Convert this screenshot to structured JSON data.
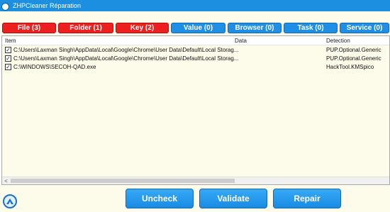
{
  "window": {
    "title": "ZHPCleaner Réparation",
    "app_icon": "zhpcleaner-logo-icon"
  },
  "tabs": [
    {
      "label": "File  (3)",
      "color": "#ee1f1f"
    },
    {
      "label": "Folder  (1)",
      "color": "#ee1f1f"
    },
    {
      "label": "Key  (2)",
      "color": "#ee1f1f"
    },
    {
      "label": "Value  (0)",
      "color": "#1f8fe6"
    },
    {
      "label": "Browser  (0)",
      "color": "#1f8fe6"
    },
    {
      "label": "Task  (0)",
      "color": "#1f8fe6"
    },
    {
      "label": "Service  (0)",
      "color": "#1f8fe6"
    }
  ],
  "list": {
    "columns": {
      "item": "Item",
      "data": "Data",
      "detection": "Detection"
    },
    "rows": [
      {
        "checked": true,
        "item": "C:\\Users\\Laxman Singh\\AppData\\Local\\Google\\Chrome\\User Data\\Default\\Local Storag...",
        "data": "",
        "detection": "PUP.Optional.Generic"
      },
      {
        "checked": true,
        "item": "C:\\Users\\Laxman Singh\\AppData\\Local\\Google\\Chrome\\User Data\\Default\\Local Storag...",
        "data": "",
        "detection": "PUP.Optional.Generic"
      },
      {
        "checked": true,
        "item": "C:\\WINDOWS\\SECOH-QAD.exe",
        "data": "",
        "detection": "HackTool.KMSpico"
      }
    ],
    "checkbox_mark": "✓",
    "scroll_left_arrow": "<"
  },
  "footer": {
    "uncheck_label": "Uncheck",
    "validate_label": "Validate",
    "repair_label": "Repair",
    "logo_icon": "zhpcleaner-logo-icon"
  },
  "colors": {
    "titlebar": "#1c8fe0",
    "background": "#fdfbe9",
    "danger": "#ee1f1f",
    "accent": "#1f8fe6"
  }
}
